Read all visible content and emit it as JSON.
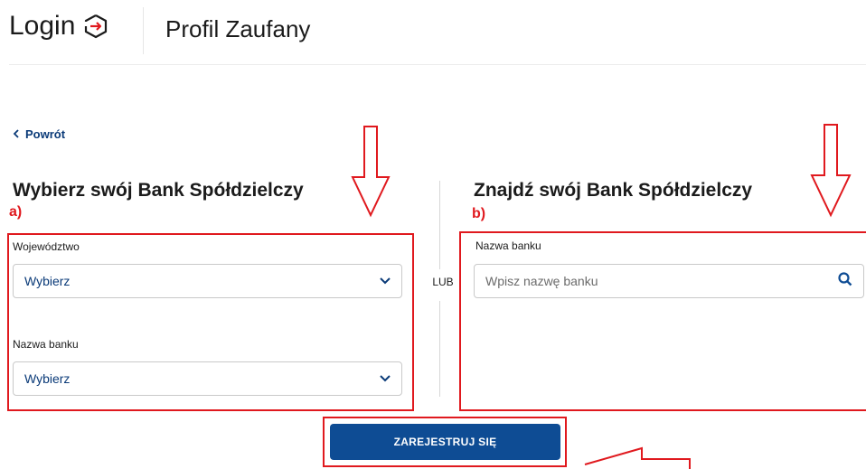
{
  "header": {
    "brand_label": "Login",
    "brand_icon": "login-arrow-icon",
    "title": "Profil Zaufany"
  },
  "back_link": {
    "label": "Powrót",
    "icon": "chevron-left-icon"
  },
  "left_section": {
    "title": "Wybierz swój Bank Spółdzielczy",
    "annotation": "a)",
    "voivodeship_label": "Województwo",
    "voivodeship_value": "Wybierz",
    "bank_name_label": "Nazwa banku",
    "bank_name_value": "Wybierz"
  },
  "or_label": "LUB",
  "right_section": {
    "title": "Znajdź swój Bank Spółdzielczy",
    "annotation": "b)",
    "search_label": "Nazwa banku",
    "search_placeholder": "Wpisz nazwę banku",
    "search_icon": "search-icon"
  },
  "register_button": {
    "label": "ZAREJESTRUJ SIĘ"
  },
  "colors": {
    "accent": "#0e4c94",
    "link": "#0a3a78",
    "annotation_red": "#e0191e"
  }
}
